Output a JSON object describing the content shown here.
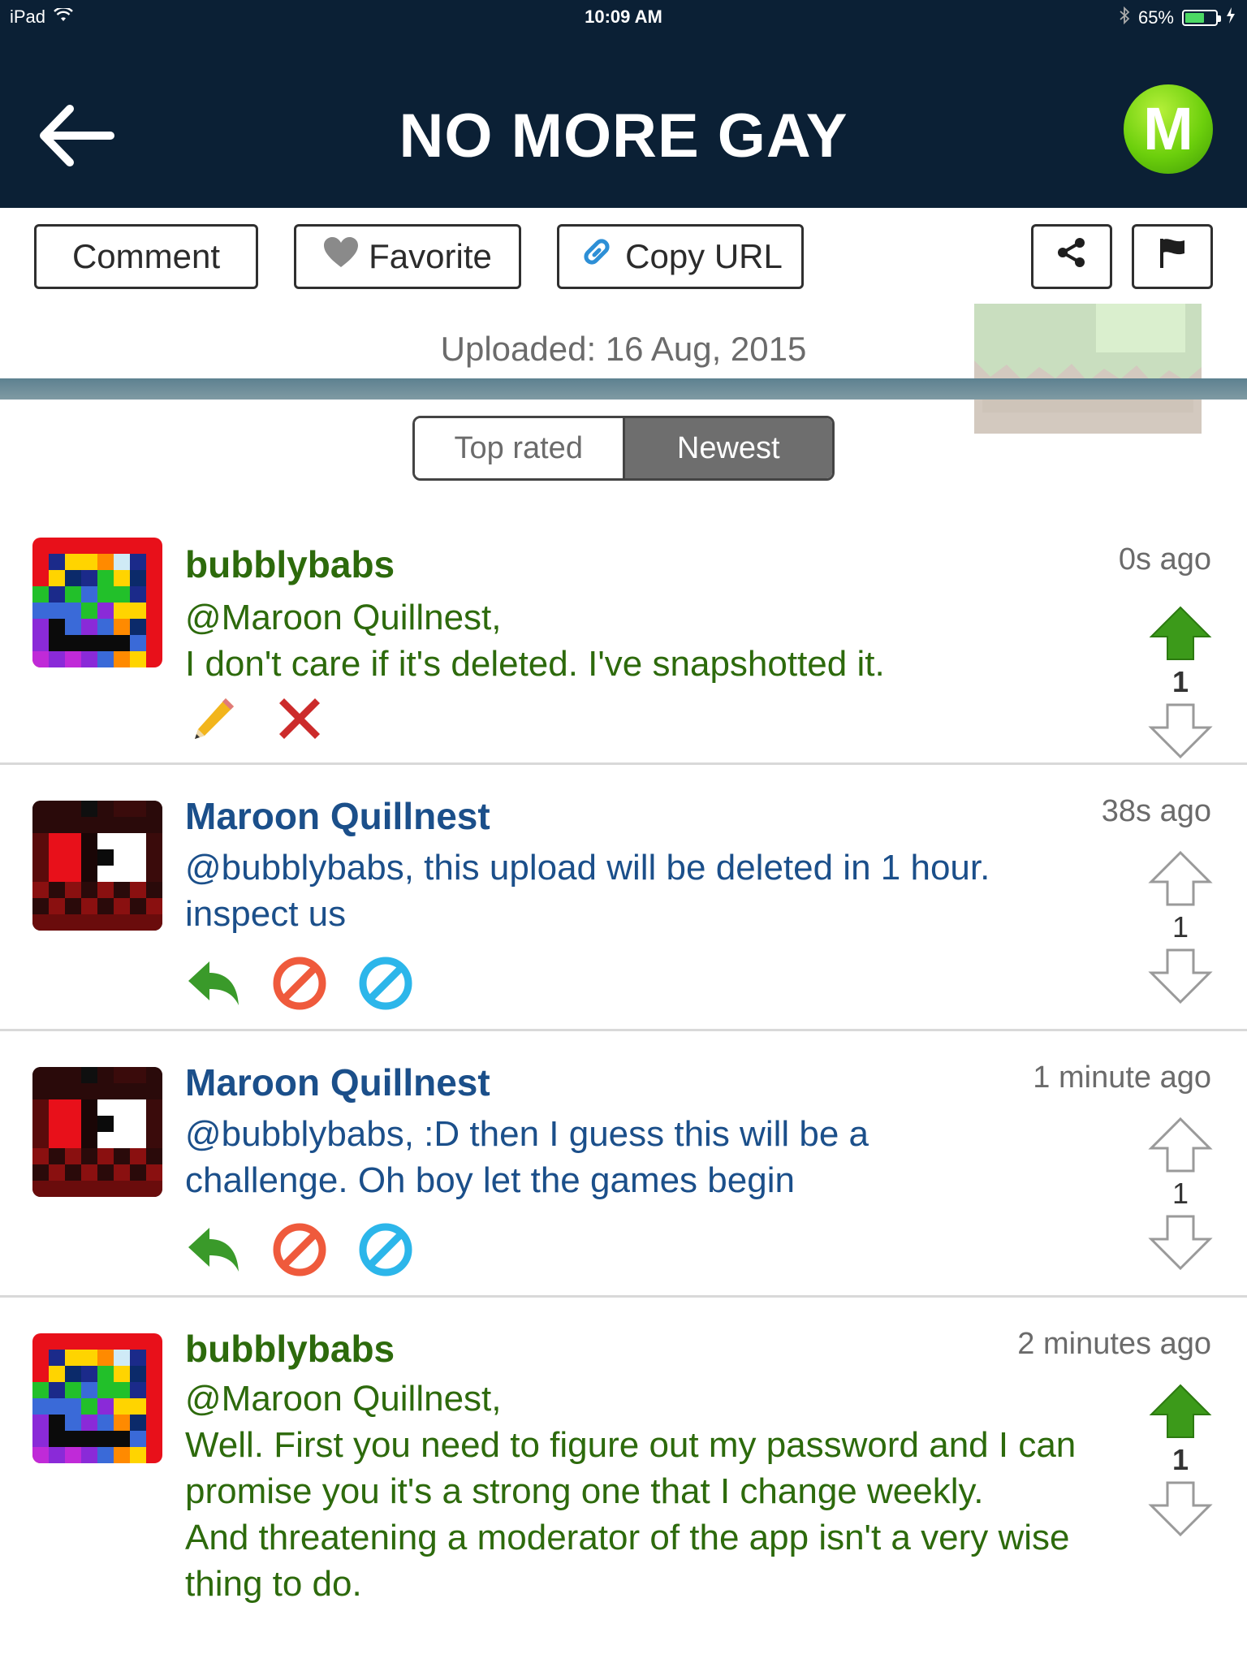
{
  "status_bar": {
    "device": "iPad",
    "time": "10:09 AM",
    "battery": "65%",
    "battery_level": 0.65
  },
  "header": {
    "title": "NO MORE GAY",
    "logo_letter": "M"
  },
  "toolbar": {
    "comment_label": "Comment",
    "favorite_label": "Favorite",
    "copy_url_label": "Copy URL",
    "uploaded": "Uploaded: 16 Aug, 2015"
  },
  "sort": {
    "top_rated": "Top rated",
    "newest": "Newest",
    "selected": "Newest"
  },
  "comments": [
    {
      "author": "bubblybabs",
      "time": "0s ago",
      "mention": "@Maroon Quillnest,",
      "text": "I don't care if it's deleted. I've snapshotted it.",
      "votes": "1",
      "upvoted": true,
      "own": true
    },
    {
      "author": "Maroon Quillnest",
      "time": "38s ago",
      "text": "@bubblybabs, this upload will be deleted in 1 hour. inspect us",
      "votes": "1",
      "upvoted": false,
      "own": false
    },
    {
      "author": "Maroon Quillnest",
      "time": "1 minute ago",
      "text": "@bubblybabs, :D then I guess this will be a challenge. Oh boy let the games begin",
      "votes": "1",
      "upvoted": false,
      "own": false
    },
    {
      "author": "bubblybabs",
      "time": "2 minutes ago",
      "mention": "@Maroon Quillnest,",
      "text": "Well. First you need to figure out my password and I can promise you it's a strong one that I change weekly.",
      "text2": "And threatening a moderator of the app isn't a very wise thing to do.",
      "votes": "1",
      "upvoted": true,
      "own": true
    }
  ],
  "colors": {
    "header_bg": "#0b2035",
    "own_comment_text": "#2d6a0c",
    "other_comment_text": "#1b4f8a",
    "upvote_active": "#3c9a1a",
    "reply": "#3a9a2a",
    "block": "#ef5a3c",
    "ban": "#2cb6ea"
  }
}
